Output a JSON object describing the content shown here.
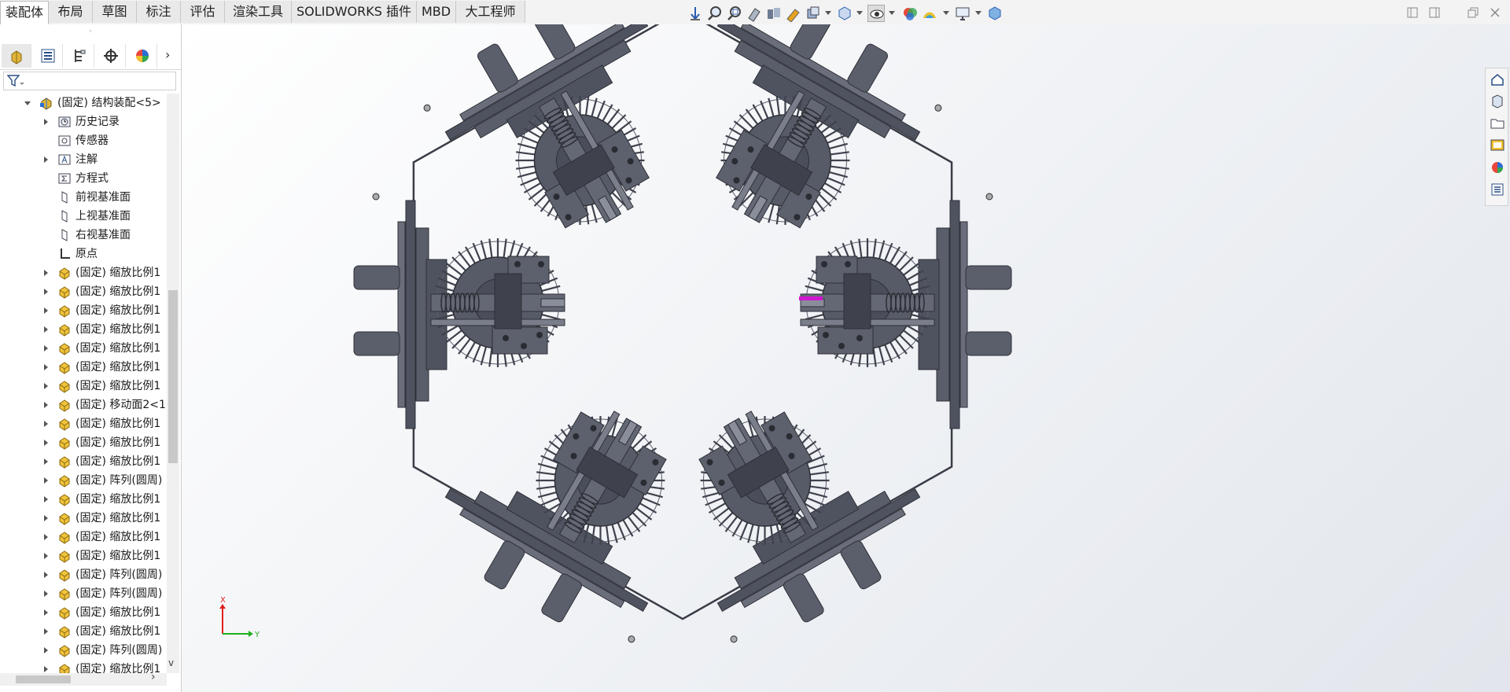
{
  "tabs": [
    {
      "label": "装配体",
      "active": true
    },
    {
      "label": "布局",
      "active": false
    },
    {
      "label": "草图",
      "active": false
    },
    {
      "label": "标注",
      "active": false
    },
    {
      "label": "评估",
      "active": false
    },
    {
      "label": "渲染工具",
      "active": false
    },
    {
      "label": "SOLIDWORKS 插件",
      "active": false
    },
    {
      "label": "MBD",
      "active": false
    },
    {
      "label": "大工程师",
      "active": false
    }
  ],
  "hud_icons": [
    "move-view-icon",
    "zoom-to-fit-icon",
    "zoom-to-area-icon",
    "previous-view-icon",
    "section-view-icon",
    "dynamic-annotation-icon",
    "view-orientation-icon",
    "display-style-icon",
    "hide-show-icon",
    "edit-appearance-icon",
    "apply-scene-icon",
    "view-settings-icon",
    "display-pane-icon"
  ],
  "feature_tree": {
    "panel_tabs": [
      "feature-manager-icon",
      "property-manager-icon",
      "configuration-manager-icon",
      "dimxpert-icon",
      "display-manager-icon"
    ],
    "root": "(固定) 结构装配<5>",
    "items": [
      {
        "label": "历史记录",
        "icon": "history-icon",
        "expandable": true
      },
      {
        "label": "传感器",
        "icon": "sensor-icon",
        "expandable": false
      },
      {
        "label": "注解",
        "icon": "annotation-icon",
        "expandable": true
      },
      {
        "label": "方程式",
        "icon": "equation-icon",
        "expandable": false
      },
      {
        "label": "前视基准面",
        "icon": "plane-icon",
        "expandable": false
      },
      {
        "label": "上视基准面",
        "icon": "plane-icon",
        "expandable": false
      },
      {
        "label": "右视基准面",
        "icon": "plane-icon",
        "expandable": false
      },
      {
        "label": "原点",
        "icon": "origin-icon",
        "expandable": false
      },
      {
        "label": "(固定) 缩放比例1",
        "icon": "part-icon",
        "expandable": true
      },
      {
        "label": "(固定) 缩放比例1",
        "icon": "part-icon",
        "expandable": true
      },
      {
        "label": "(固定) 缩放比例1",
        "icon": "part-icon",
        "expandable": true
      },
      {
        "label": "(固定) 缩放比例1",
        "icon": "part-icon",
        "expandable": true
      },
      {
        "label": "(固定) 缩放比例1",
        "icon": "part-icon",
        "expandable": true
      },
      {
        "label": "(固定) 缩放比例1",
        "icon": "part-icon",
        "expandable": true
      },
      {
        "label": "(固定) 缩放比例1",
        "icon": "part-icon",
        "expandable": true
      },
      {
        "label": "(固定) 移动面2<1",
        "icon": "part-icon",
        "expandable": true
      },
      {
        "label": "(固定) 缩放比例1",
        "icon": "part-icon",
        "expandable": true
      },
      {
        "label": "(固定) 缩放比例1",
        "icon": "part-icon",
        "expandable": true
      },
      {
        "label": "(固定) 缩放比例1",
        "icon": "part-icon",
        "expandable": true
      },
      {
        "label": "(固定) 阵列(圆周)",
        "icon": "part-icon",
        "expandable": true
      },
      {
        "label": "(固定) 缩放比例1",
        "icon": "part-icon",
        "expandable": true
      },
      {
        "label": "(固定) 缩放比例1",
        "icon": "part-icon",
        "expandable": true
      },
      {
        "label": "(固定) 缩放比例1",
        "icon": "part-icon",
        "expandable": true
      },
      {
        "label": "(固定) 缩放比例1",
        "icon": "part-icon",
        "expandable": true
      },
      {
        "label": "(固定) 阵列(圆周)",
        "icon": "part-icon",
        "expandable": true
      },
      {
        "label": "(固定) 阵列(圆周)",
        "icon": "part-icon",
        "expandable": true
      },
      {
        "label": "(固定) 缩放比例1",
        "icon": "part-icon",
        "expandable": true
      },
      {
        "label": "(固定) 缩放比例1",
        "icon": "part-icon",
        "expandable": true
      },
      {
        "label": "(固定) 阵列(圆周)",
        "icon": "part-icon",
        "expandable": true
      },
      {
        "label": "(固定) 缩放比例1",
        "icon": "part-icon",
        "expandable": true
      }
    ]
  },
  "triad": {
    "x_label": "X",
    "y_label": "Y"
  },
  "task_pane": [
    "home-icon",
    "design-library-icon",
    "file-explorer-icon",
    "view-palette-icon",
    "appearances-icon",
    "custom-properties-icon"
  ],
  "colors": {
    "model": "#4f5360",
    "model_dark": "#2e3038",
    "highlight": "#d017d0",
    "axis_x": "#e02020",
    "axis_y": "#20b020"
  }
}
